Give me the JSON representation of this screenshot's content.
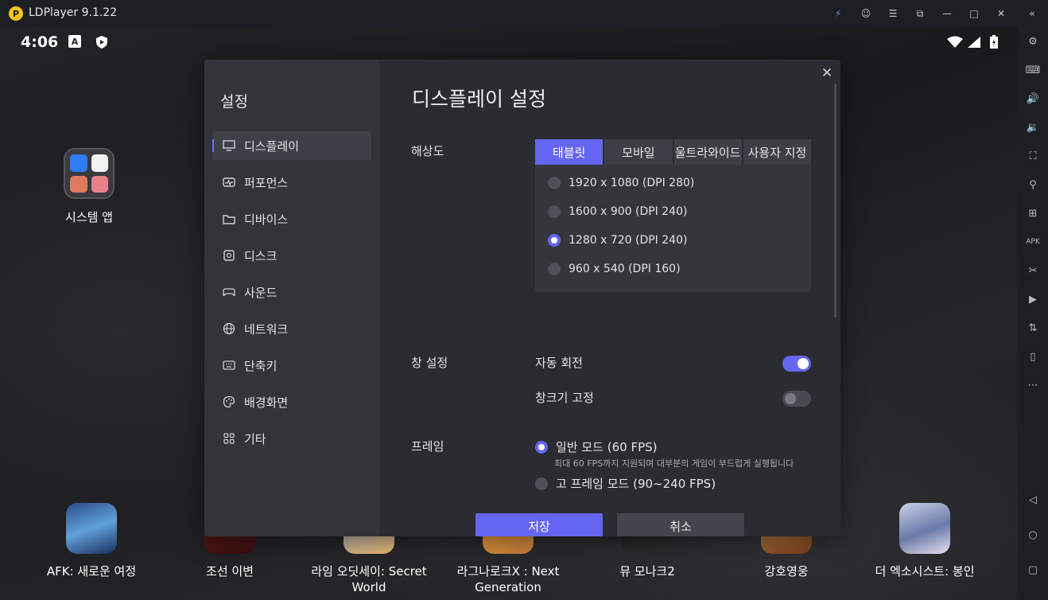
{
  "window": {
    "title": "LDPlayer 9.1.22",
    "logo_letter": "P"
  },
  "titlebar_icons": [
    "bolt-icon",
    "account-icon",
    "menu-icon",
    "popout-icon",
    "minimize-icon",
    "maximize-icon",
    "close-icon",
    "collapse-icon"
  ],
  "status": {
    "time": "4:06",
    "left_icons": [
      "font-icon",
      "shield-play-icon"
    ],
    "right_icons": [
      "wifi-icon",
      "signal-icon",
      "battery-icon"
    ]
  },
  "home": {
    "folder_label": "시스템 앱",
    "apps": [
      {
        "label": "AFK: 새로운 여정"
      },
      {
        "label": "조선 이변"
      },
      {
        "label": "라임 오딧세이: Secret World"
      },
      {
        "label": "라그나로크X : Next Generation"
      },
      {
        "label": "뮤 모나크2"
      },
      {
        "label": "강호영웅"
      },
      {
        "label": "더 엑소시스트: 봉인"
      }
    ]
  },
  "side_toolbar": [
    "settings-icon",
    "keyboard-icon",
    "volume-up-icon",
    "volume-down-icon",
    "screenshot-icon",
    "location-icon",
    "add-app-icon",
    "apk-icon",
    "scissors-icon",
    "record-icon",
    "sync-icon",
    "shake-icon",
    "more-icon",
    "back-icon",
    "home-icon",
    "recents-icon"
  ],
  "dialog": {
    "nav_title": "설정",
    "nav": [
      "디스플레이",
      "퍼포먼스",
      "디바이스",
      "디스크",
      "사운드",
      "네트워크",
      "단축키",
      "배경화면",
      "기타"
    ],
    "heading": "디스플레이 설정",
    "resolution": {
      "label": "해상도",
      "tabs": [
        "태블릿",
        "모바일",
        "울트라와이드",
        "사용자 지정"
      ],
      "active_tab": "태블릿",
      "options": [
        {
          "text": "1920 x 1080  (DPI 280)",
          "selected": false
        },
        {
          "text": "1600 x 900  (DPI 240)",
          "selected": false
        },
        {
          "text": "1280 x 720  (DPI 240)",
          "selected": true
        },
        {
          "text": "960 x 540  (DPI 160)",
          "selected": false
        }
      ]
    },
    "window": {
      "label": "창 설정",
      "auto_rotate": "자동 회전",
      "auto_rotate_on": true,
      "fix_size": "창크기 고정",
      "fix_size_on": false
    },
    "frame": {
      "label": "프레임",
      "normal": "일반 모드 (60 FPS)",
      "normal_desc": "최대 60 FPS까지 지원되며 대부분의 게임이 부드럽게 실행됩니다",
      "high": "고 프레임 모드 (90~240 FPS)",
      "selected": "normal"
    },
    "save": "저장",
    "cancel": "취소"
  },
  "colors": {
    "accent": "#6466f1",
    "dialog_bg": "#2b2c31",
    "nav_bg": "#33343a"
  }
}
